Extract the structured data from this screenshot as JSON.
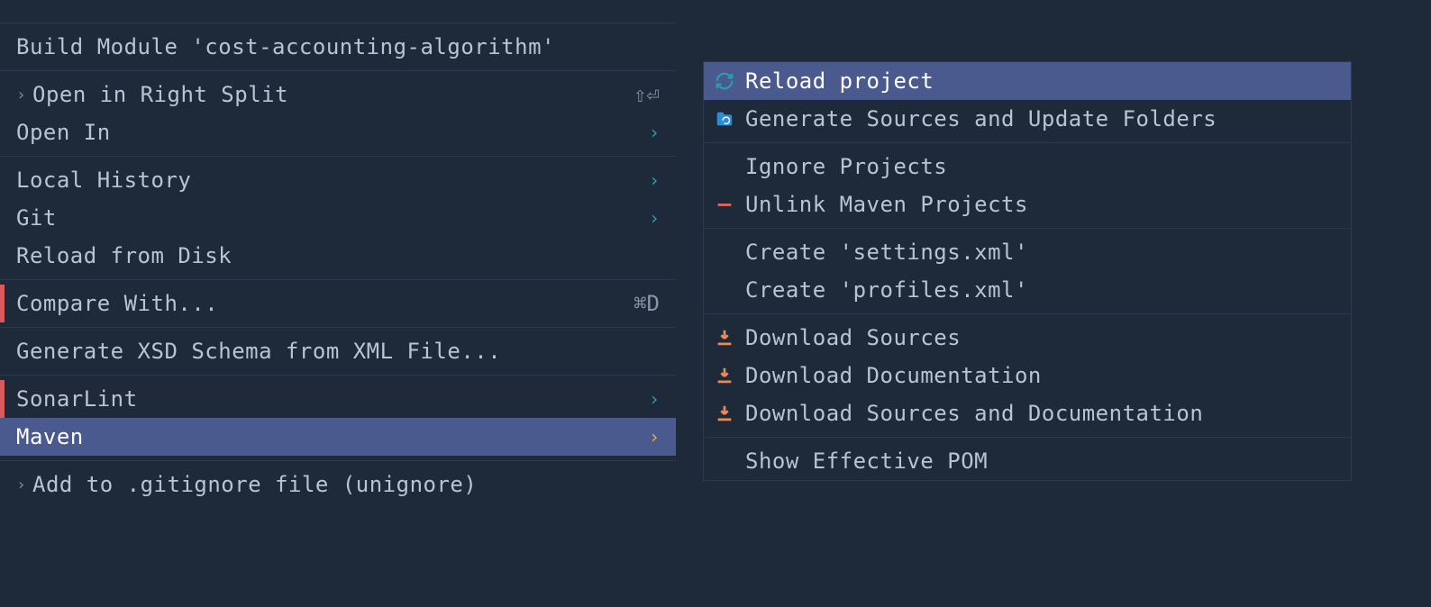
{
  "leftMenu": {
    "items": [
      {
        "label": "Build Module 'cost-accounting-algorithm'",
        "shortcut": "",
        "arrow": false,
        "marker": "",
        "chevron": false
      },
      {
        "label": "Open in Right Split",
        "shortcut": "⇧⏎",
        "arrow": false,
        "marker": "",
        "chevron": true
      },
      {
        "label": "Open In",
        "shortcut": "",
        "arrow": true,
        "marker": "",
        "chevron": false
      },
      {
        "label": "Local History",
        "shortcut": "",
        "arrow": true,
        "marker": "",
        "chevron": false
      },
      {
        "label": "Git",
        "shortcut": "",
        "arrow": true,
        "marker": "",
        "chevron": false
      },
      {
        "label": "Reload from Disk",
        "shortcut": "",
        "arrow": false,
        "marker": "",
        "chevron": false
      },
      {
        "label": "Compare With...",
        "shortcut": "⌘D",
        "arrow": false,
        "marker": "red",
        "chevron": false
      },
      {
        "label": "Generate XSD Schema from XML File...",
        "shortcut": "",
        "arrow": false,
        "marker": "",
        "chevron": false
      },
      {
        "label": "SonarLint",
        "shortcut": "",
        "arrow": true,
        "marker": "red",
        "chevron": false
      },
      {
        "label": "Maven",
        "shortcut": "",
        "arrow": true,
        "marker": "",
        "chevron": false,
        "highlighted": true
      },
      {
        "label": "Add to .gitignore file (unignore)",
        "shortcut": "",
        "arrow": false,
        "marker": "",
        "chevron": true
      }
    ]
  },
  "rightMenu": {
    "items": [
      {
        "label": "Reload project",
        "icon": "reload",
        "highlighted": true
      },
      {
        "label": "Generate Sources and Update Folders",
        "icon": "folder-reload"
      },
      {
        "label": "Ignore Projects",
        "icon": ""
      },
      {
        "label": "Unlink Maven Projects",
        "icon": "minus"
      },
      {
        "label": "Create 'settings.xml'",
        "icon": ""
      },
      {
        "label": "Create 'profiles.xml'",
        "icon": ""
      },
      {
        "label": "Download Sources",
        "icon": "download"
      },
      {
        "label": "Download Documentation",
        "icon": "download"
      },
      {
        "label": "Download Sources and Documentation",
        "icon": "download"
      },
      {
        "label": "Show Effective POM",
        "icon": ""
      }
    ]
  }
}
